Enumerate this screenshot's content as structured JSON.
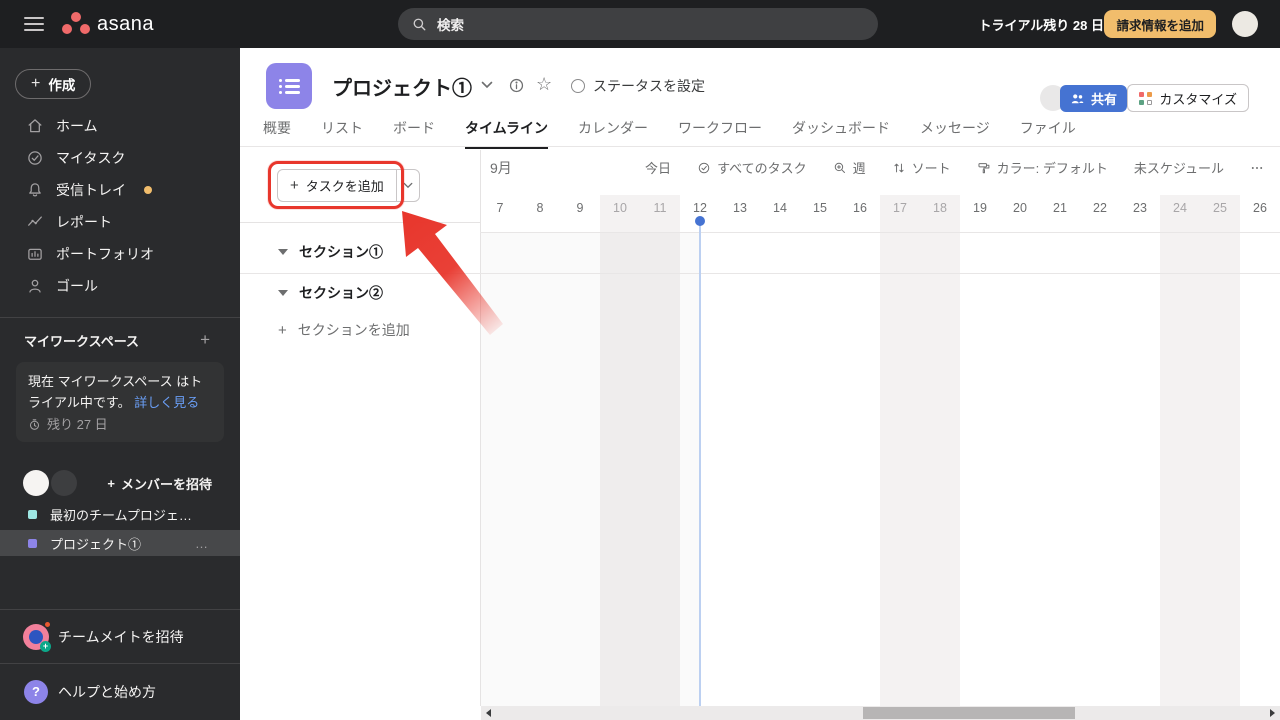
{
  "topbar": {
    "logo_text": "asana",
    "search_placeholder": "検索",
    "trial_label": "トライアル残り 28 日",
    "billing_button": "請求情報を追加"
  },
  "sidebar": {
    "create_button": "作成",
    "nav": [
      {
        "id": "home",
        "icon": "home",
        "label": "ホーム"
      },
      {
        "id": "my-tasks",
        "icon": "check-circle",
        "label": "マイタスク"
      },
      {
        "id": "inbox",
        "icon": "bell",
        "label": "受信トレイ",
        "badge": true
      },
      {
        "id": "reporting",
        "icon": "chart-line",
        "label": "レポート"
      },
      {
        "id": "portfolio",
        "icon": "portfolio",
        "label": "ポートフォリオ"
      },
      {
        "id": "goals",
        "icon": "goals",
        "label": "ゴール"
      }
    ],
    "workspace_header": "マイワークスペース",
    "trial_card": {
      "text": "現在 マイワークスペース はトライアル中です。",
      "link": "詳しく見る",
      "remaining": "残り 27 日"
    },
    "invite_members": "メンバーを招待",
    "projects": [
      {
        "label": "最初のチームプロジェ…",
        "color": "#9ee7e3",
        "selected": false
      },
      {
        "label": "プロジェクト①",
        "color": "#8d84e8",
        "selected": true,
        "more": "…"
      }
    ],
    "invite_teammates": "チームメイトを招待",
    "help": "ヘルプと始め方"
  },
  "header": {
    "project_title": "プロジェクト①",
    "status_label": "ステータスを設定",
    "share_button": "共有",
    "customize_button": "カスタマイズ"
  },
  "tabs": {
    "active_index": 3,
    "items": [
      {
        "id": "overview",
        "label": "概要"
      },
      {
        "id": "list",
        "label": "リスト"
      },
      {
        "id": "board",
        "label": "ボード"
      },
      {
        "id": "timeline",
        "label": "タイムライン"
      },
      {
        "id": "calendar",
        "label": "カレンダー"
      },
      {
        "id": "workflow",
        "label": "ワークフロー"
      },
      {
        "id": "dashboard",
        "label": "ダッシュボード"
      },
      {
        "id": "messages",
        "label": "メッセージ"
      },
      {
        "id": "files",
        "label": "ファイル"
      }
    ]
  },
  "toolbar": {
    "add_task_label": "タスクを追加",
    "items": [
      {
        "id": "today",
        "icon": "",
        "label": "今日"
      },
      {
        "id": "all-tasks",
        "icon": "check-circle",
        "label": "すべてのタスク"
      },
      {
        "id": "zoom-week",
        "icon": "zoom-plus",
        "label": "週"
      },
      {
        "id": "sort",
        "icon": "sort",
        "label": "ソート"
      },
      {
        "id": "color",
        "icon": "roller",
        "label": "カラー: デフォルト"
      },
      {
        "id": "unscheduled",
        "icon": "",
        "label": "未スケジュール"
      },
      {
        "id": "more",
        "icon": "dots",
        "label": ""
      }
    ]
  },
  "timeline": {
    "month": "9月",
    "dates": [
      7,
      8,
      9,
      10,
      11,
      12,
      13,
      14,
      15,
      16,
      17,
      18,
      19,
      20,
      21,
      22,
      23,
      24,
      25,
      26
    ],
    "weekend_days": [
      10,
      11,
      17,
      18,
      24,
      25
    ],
    "today": 12
  },
  "sections": {
    "items": [
      "セクション①",
      "セクション②"
    ],
    "add_label": "セクションを追加"
  },
  "colors": {
    "annotation_red": "#e8362c",
    "brand_coral": "#f06a6a",
    "share_blue": "#4573d2",
    "today_blue": "#4573d2",
    "trial_amber": "#f1bd6c",
    "project_purple": "#8d84e8",
    "project_teal": "#9ee7e3"
  }
}
